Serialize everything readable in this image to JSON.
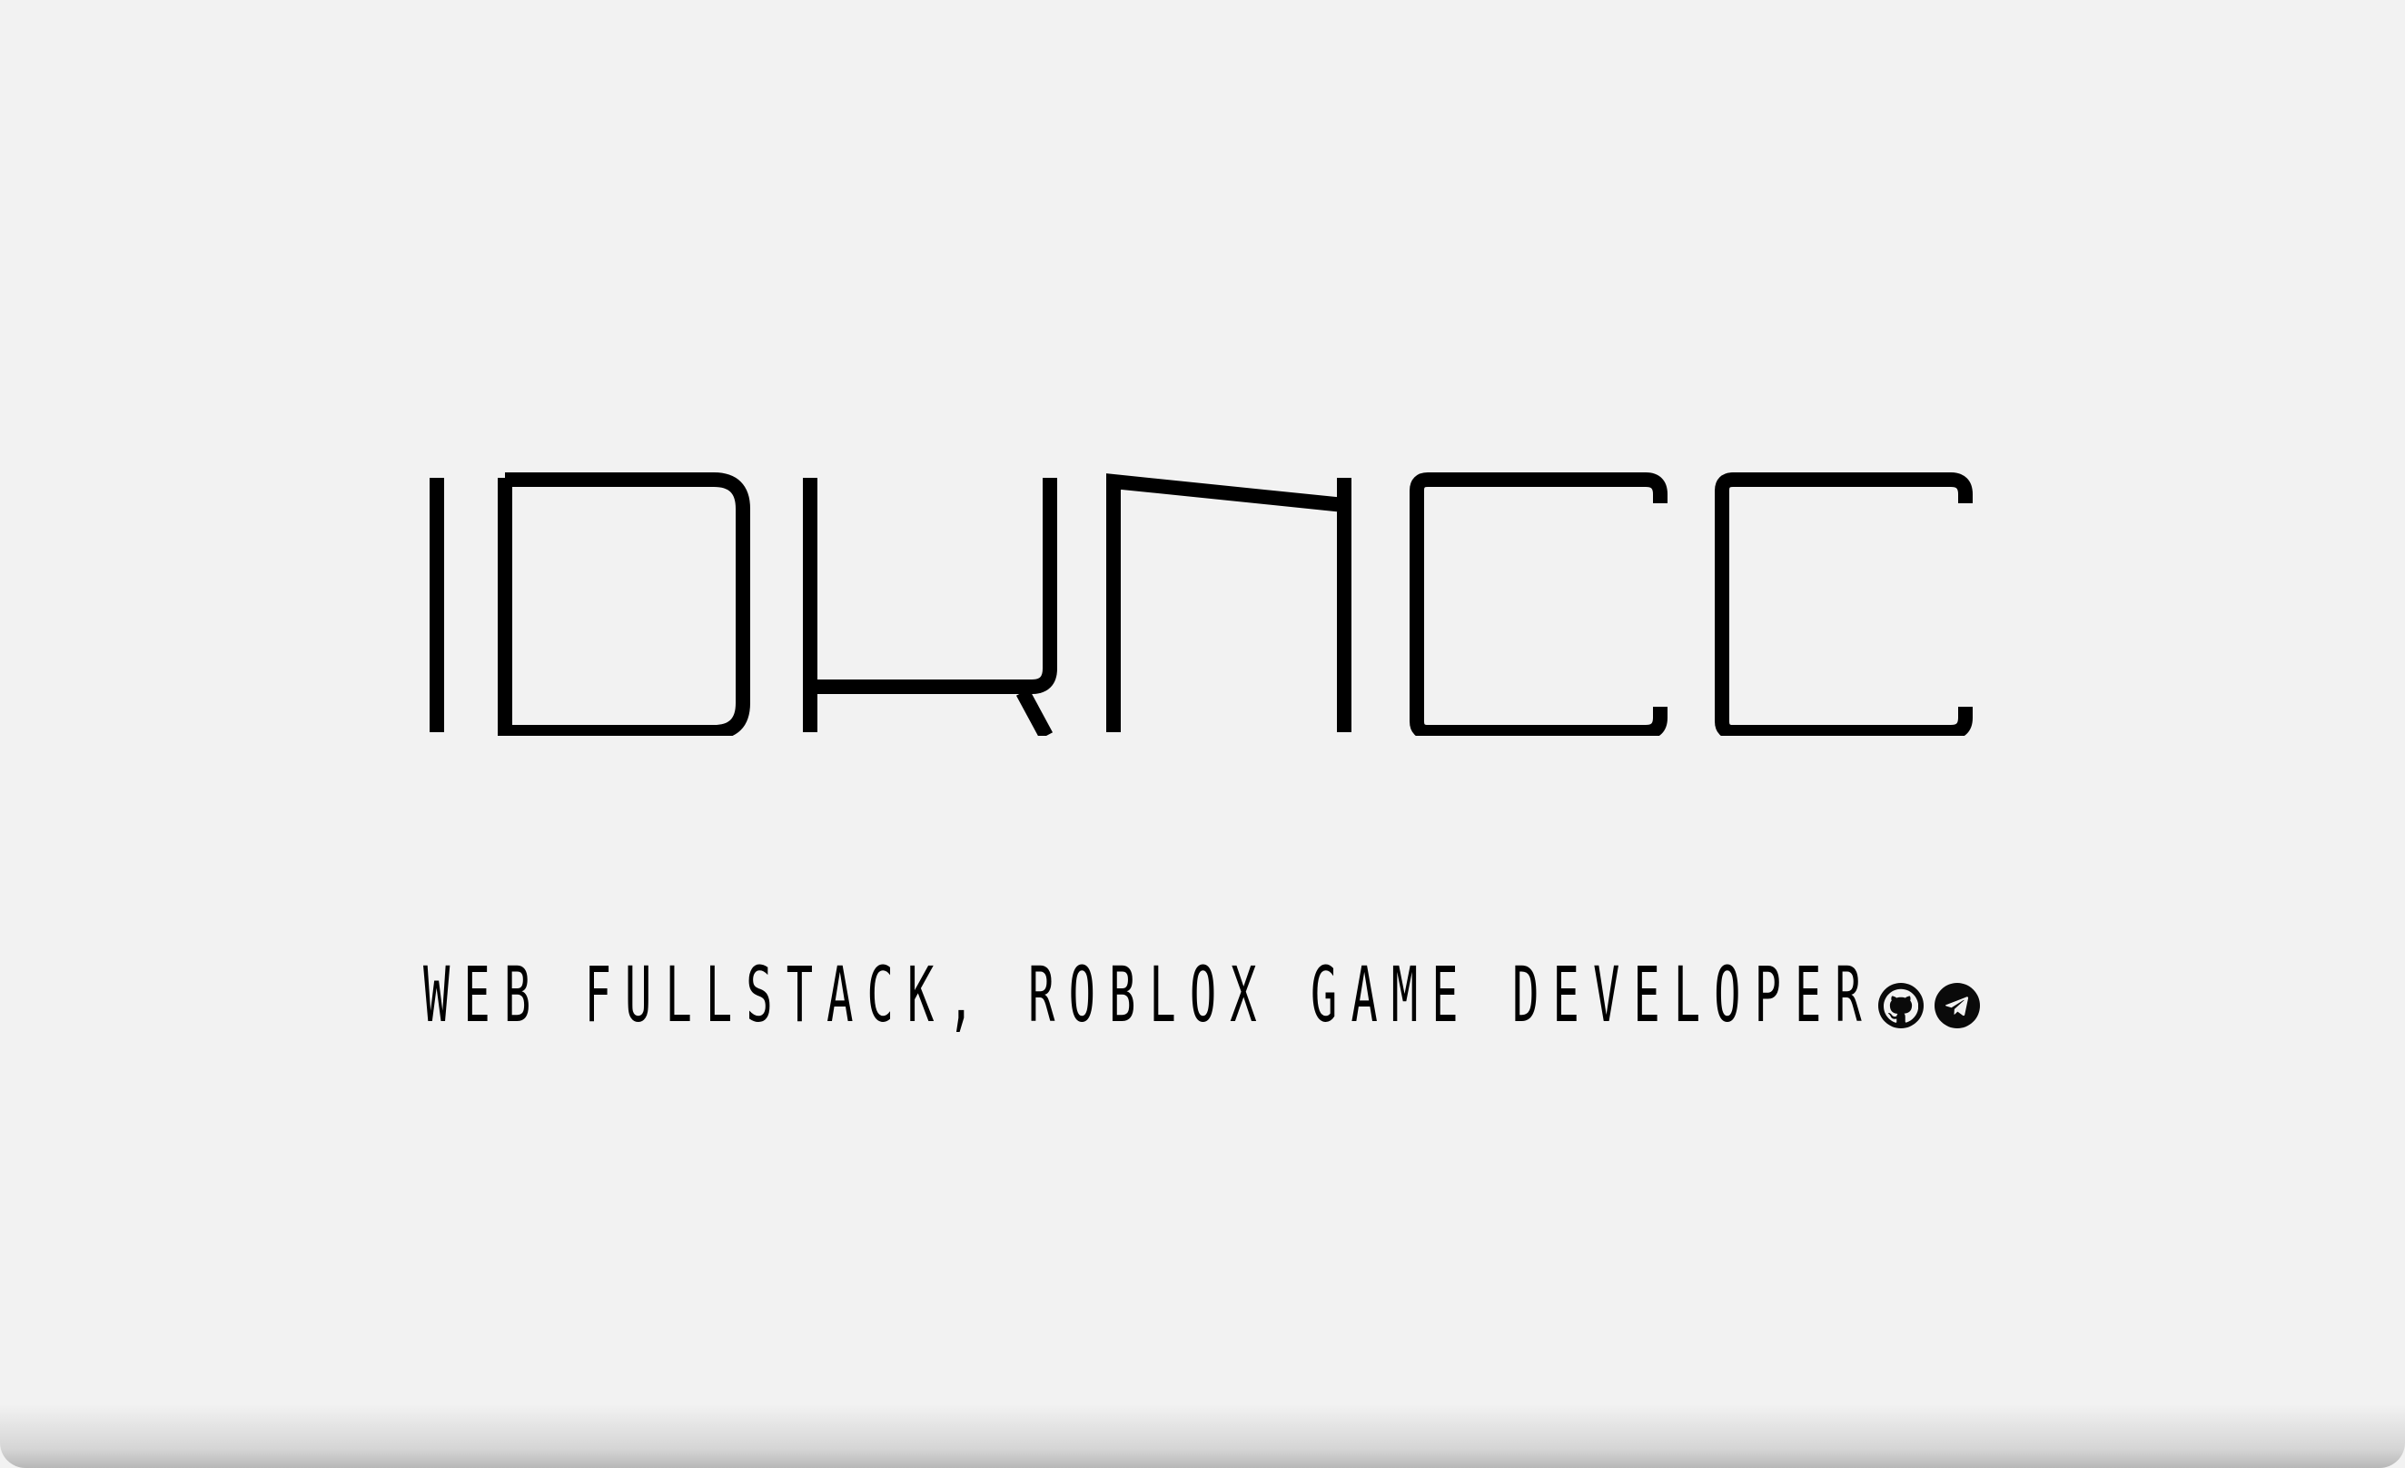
{
  "brand": {
    "logo_text": "IDKNCC"
  },
  "hero": {
    "tagline": "WEB FULLSTACK, ROBLOX GAME DEVELOPER"
  },
  "social": [
    {
      "icon": "github-icon"
    },
    {
      "icon": "telegram-icon"
    }
  ],
  "colors": {
    "background": "#f2f2f2",
    "foreground": "#000000"
  }
}
